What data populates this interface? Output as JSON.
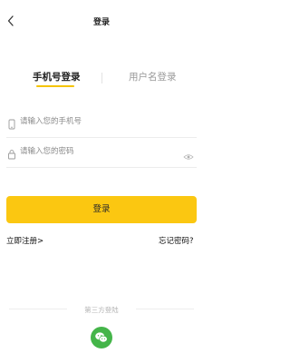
{
  "header": {
    "title": "登录"
  },
  "tabs": [
    {
      "label": "手机号登录",
      "active": true
    },
    {
      "label": "用户名登录",
      "active": false
    }
  ],
  "form": {
    "phone": {
      "value": "",
      "placeholder": "请输入您的手机号"
    },
    "password": {
      "value": "",
      "placeholder": "请输入您的密码"
    }
  },
  "login_button": {
    "label": "登录"
  },
  "links": {
    "register": "立即注册>",
    "forgot": "忘记密码?"
  },
  "third_party": {
    "label": "第三方登陆",
    "providers": [
      "wechat-icon"
    ]
  },
  "colors": {
    "accent": "#FBC711",
    "wechat": "#44B549"
  }
}
